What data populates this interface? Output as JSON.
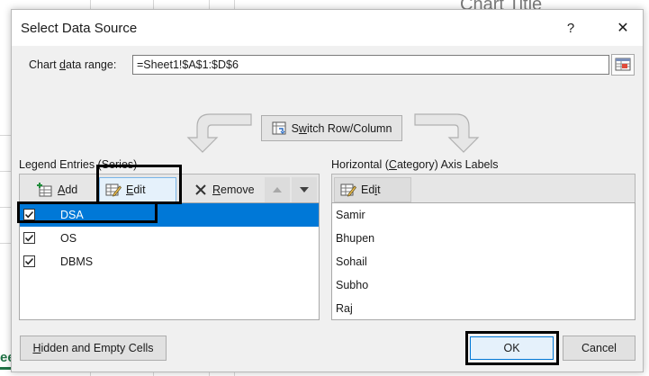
{
  "background": {
    "chart_title": "Chart Title",
    "sheet_tab_fragment": "ee"
  },
  "dialog": {
    "title": "Select Data Source",
    "help_label": "?",
    "close_label": "✕",
    "data_range": {
      "label_prefix": "Chart ",
      "label_accel": "d",
      "label_suffix": "ata range:",
      "value": "=Sheet1!$A$1:$D$6"
    },
    "switch_button": {
      "accel": "w",
      "prefix": "S",
      "suffix": "itch Row/Column"
    },
    "legend": {
      "heading": "Legend Entries (Series)",
      "toolbar": {
        "add": {
          "accel": "A",
          "rest": "dd"
        },
        "edit": {
          "accel": "E",
          "rest": "dit"
        },
        "remove": {
          "accel": "R",
          "rest": "emove"
        }
      },
      "items": [
        {
          "label": "DSA",
          "checked": true,
          "selected": true
        },
        {
          "label": "OS",
          "checked": true,
          "selected": false
        },
        {
          "label": "DBMS",
          "checked": true,
          "selected": false
        }
      ]
    },
    "axis": {
      "heading_prefix": "Horizontal (",
      "heading_accel": "C",
      "heading_suffix": "ategory) Axis Labels",
      "edit": {
        "accel": "i",
        "prefix": "Ed",
        "suffix": "t"
      },
      "items": [
        "Samir",
        "Bhupen",
        "Sohail",
        "Subho",
        "Raj"
      ]
    },
    "footer": {
      "hidden_empty": {
        "accel": "H",
        "rest": "idden and Empty Cells"
      },
      "ok": "OK",
      "cancel": "Cancel"
    },
    "colors": {
      "selection": "#0078d7",
      "dialog_bg": "#f0f0f0",
      "highlight_box": "#000000"
    }
  }
}
